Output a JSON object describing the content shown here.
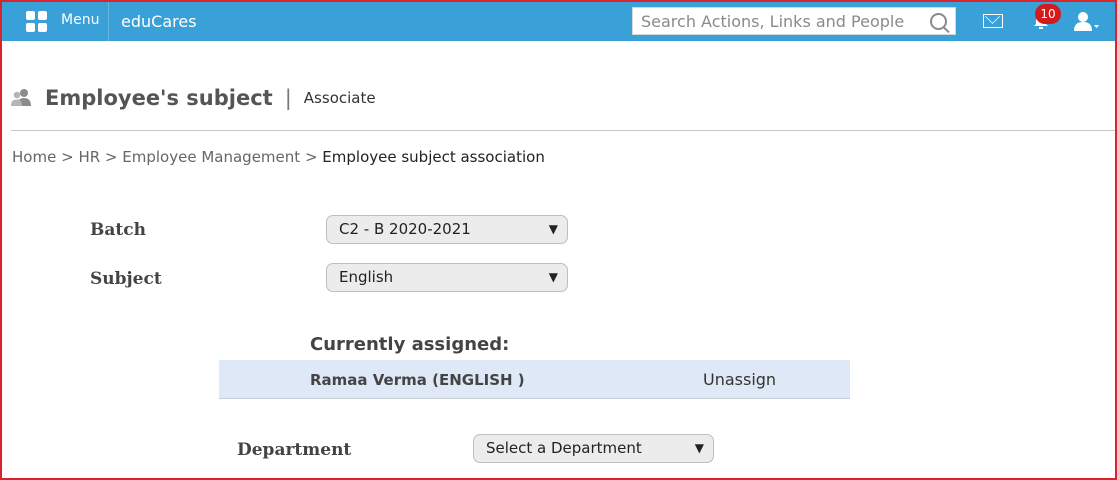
{
  "topbar": {
    "menu_label": "Menu",
    "brand": "eduCares",
    "search_placeholder": "Search Actions, Links and People",
    "notifications_count": "10",
    "accent_color": "#3aa0d8",
    "badge_color": "#d41b1b"
  },
  "page": {
    "title": "Employee's subject",
    "separator": "|",
    "subtitle": "Associate"
  },
  "breadcrumb": {
    "items": [
      "Home",
      "HR",
      "Employee Management"
    ],
    "separator": ">",
    "current": "Employee subject association"
  },
  "form": {
    "batch_label": "Batch",
    "batch_value": "C2 - B 2020-2021",
    "subject_label": "Subject",
    "subject_value": "English",
    "department_label": "Department",
    "department_value": "Select a Department",
    "dropdown_arrow": "▼"
  },
  "assigned": {
    "title": "Currently assigned:",
    "rows": [
      {
        "name": "Ramaa Verma (ENGLISH )",
        "action": "Unassign"
      }
    ]
  }
}
